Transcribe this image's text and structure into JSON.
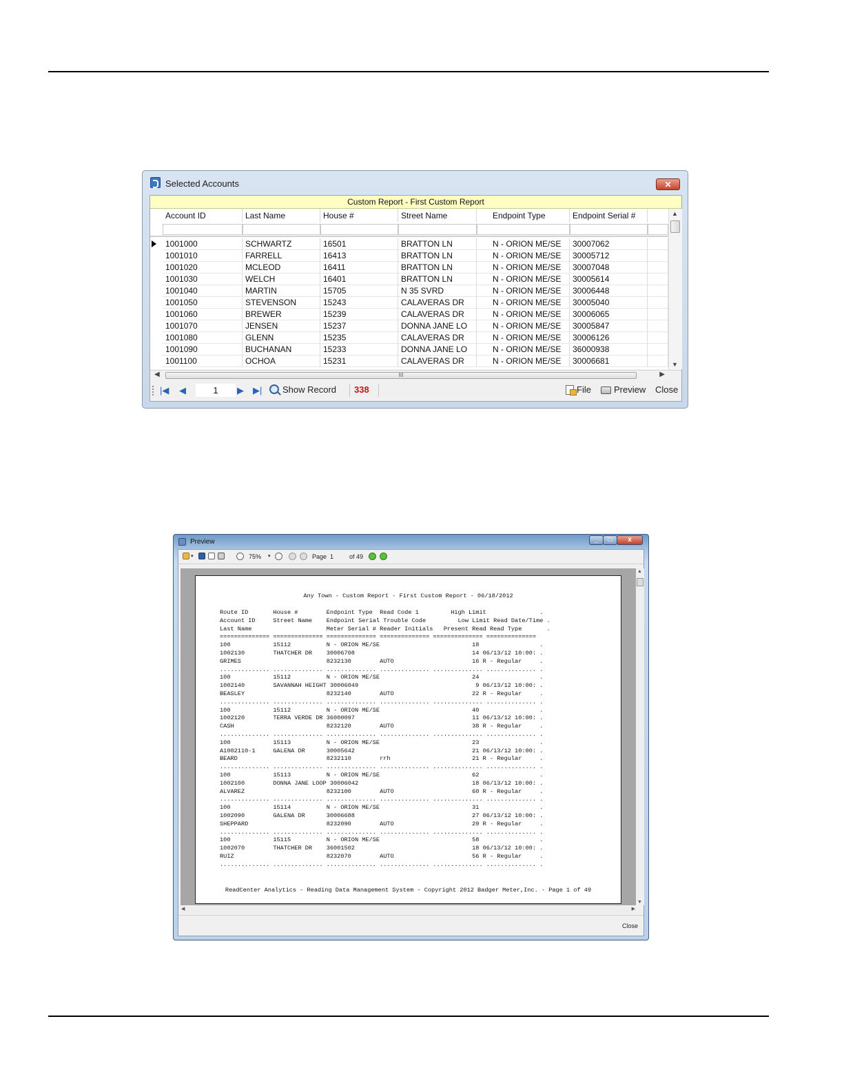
{
  "selected_accounts": {
    "title": "Selected Accounts",
    "close_glyph": "✕",
    "report_band": "Custom Report - First Custom Report",
    "columns": [
      "Account ID",
      "Last Name",
      "House #",
      "Street Name",
      "Endpoint Type",
      "Endpoint Serial #"
    ],
    "rows": [
      [
        "1001000",
        "SCHWARTZ",
        "16501",
        "BRATTON LN",
        "N - ORION ME/SE",
        "30007062"
      ],
      [
        "1001010",
        "FARRELL",
        "16413",
        "BRATTON LN",
        "N - ORION ME/SE",
        "30005712"
      ],
      [
        "1001020",
        "MCLEOD",
        "16411",
        "BRATTON LN",
        "N - ORION ME/SE",
        "30007048"
      ],
      [
        "1001030",
        "WELCH",
        "16401",
        "BRATTON LN",
        "N - ORION ME/SE",
        "30005614"
      ],
      [
        "1001040",
        "MARTIN",
        "15705",
        "N 35 SVRD",
        "N - ORION ME/SE",
        "30006448"
      ],
      [
        "1001050",
        "STEVENSON",
        "15243",
        "CALAVERAS DR",
        "N - ORION ME/SE",
        "30005040"
      ],
      [
        "1001060",
        "BREWER",
        "15239",
        "CALAVERAS DR",
        "N - ORION ME/SE",
        "30006065"
      ],
      [
        "1001070",
        "JENSEN",
        "15237",
        "DONNA JANE LO",
        "N - ORION ME/SE",
        "30005847"
      ],
      [
        "1001080",
        "GLENN",
        "15235",
        "CALAVERAS DR",
        "N - ORION ME/SE",
        "30006126"
      ],
      [
        "1001090",
        "BUCHANAN",
        "15233",
        "DONNA JANE LO",
        "N - ORION ME/SE",
        "36000938"
      ],
      [
        "1001100",
        "OCHOA",
        "15231",
        "CALAVERAS DR",
        "N - ORION ME/SE",
        "30006681"
      ]
    ],
    "scroll_grip": "III",
    "toolbar": {
      "first_glyph": "|◀",
      "prev_glyph": "◀",
      "page": "1",
      "next_glyph": "▶",
      "last_glyph": "▶|",
      "show_record": "Show Record",
      "record_count": "338",
      "file": "File",
      "preview": "Preview",
      "close": "Close"
    }
  },
  "preview": {
    "title": "Preview",
    "toolbar": {
      "zoom": "75%",
      "page_label": "Page",
      "page": "1",
      "of_pages": "of 49"
    },
    "report_title": "Any Town - Custom Report - First Custom Report - 06/18/2012",
    "report_body": "Route ID       House #        Endpoint Type  Read Code 1         High Limit               .\nAccount ID     Street Name    Endpoint Serial Trouble Code         Low Limit Read Date/Time .\nLast Name                     Meter Serial # Reader Initials   Present Read Read Type       .\n============== ============== ============== ============== ============== ==============\n100            15112          N - ORION ME/SE                          18                 .\n1002130        THATCHER DR    30006708                                 14 06/13/12 10:00: .\nGRIMES                        8232130        AUTO                      16 R - Regular     .\n.............. .............. .............. .............. .............. .............. .\n100            15112          N - ORION ME/SE                          24                 .\n1002140        SAVANNAH HEIGHT 30006049                                 9 06/13/12 10:00: .\nBEASLEY                       8232140        AUTO                      22 R - Regular     .\n.............. .............. .............. .............. .............. .............. .\n100            15112          N - ORION ME/SE                          40                 .\n1002120        TERRA VERDE DR 36000097                                 11 06/13/12 10:00: .\nCASH                          8232120        AUTO                      38 R - Regular     .\n.............. .............. .............. .............. .............. .............. .\n100            15113          N - ORION ME/SE                          23                 .\nA1002110-1     GALENA DR      30005642                                 21 06/13/12 10:00: .\nBEARD                         8232110        rrh                       21 R - Regular     .\n.............. .............. .............. .............. .............. .............. .\n100            15113          N - ORION ME/SE                          62                 .\n1002100        DONNA JANE LOOP 30006042                                18 06/13/12 10:00: .\nALVAREZ                       8232100        AUTO                      60 R - Regular     .\n.............. .............. .............. .............. .............. .............. .\n100            15114          N - ORION ME/SE                          31                 .\n1002090        GALENA DR      30006688                                 27 06/13/12 10:00: .\nSHEPPARD                      8232090        AUTO                      29 R - Regular     .\n.............. .............. .............. .............. .............. .............. .\n100            15115          N - ORION ME/SE                          58                 .\n1002070        THATCHER DR    36001502                                 18 06/13/12 10:00: .\nRUIZ                          8232070        AUTO                      56 R - Regular     .\n.............. .............. .............. .............. .............. .............. .",
    "report_footer": "ReadCenter Analytics - Reading Data Management System - Copyright 2012 Badger Meter,Inc. - Page 1 of 49",
    "close": "Close"
  }
}
